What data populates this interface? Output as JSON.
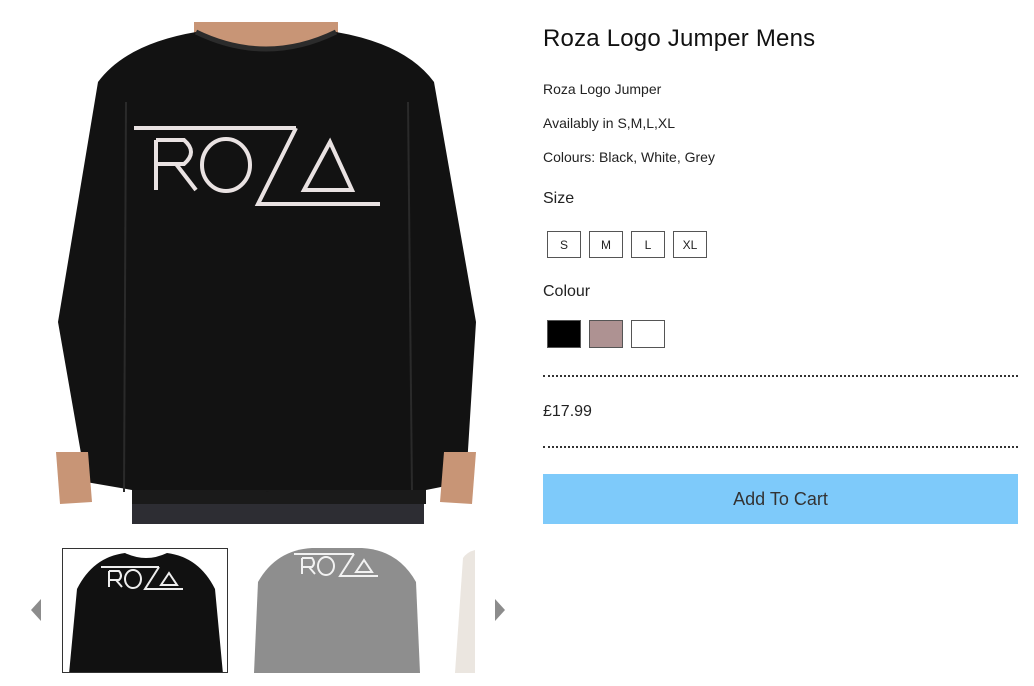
{
  "product": {
    "title": "Roza Logo Jumper Mens",
    "description_lines": [
      "Roza Logo Jumper",
      "Availably in S,M,L,XL",
      "Colours: Black, White, Grey"
    ],
    "price": "£17.99"
  },
  "options": {
    "size_label": "Size",
    "sizes": [
      "S",
      "M",
      "L",
      "XL"
    ],
    "colour_label": "Colour",
    "colours": [
      "#000000",
      "#ae9292",
      "#ffffff"
    ]
  },
  "cart": {
    "add_label": "Add To Cart",
    "button_color": "#7ecafa"
  },
  "gallery": {
    "logo_text": "ROZA",
    "thumbnails": [
      {
        "jumper_color": "#111111",
        "selected": true
      },
      {
        "jumper_color": "#8e8e8e",
        "selected": false
      },
      {
        "jumper_color": "#ebe6e0",
        "selected": false
      }
    ],
    "prev_icon": "caret-left-icon",
    "next_icon": "caret-right-icon"
  }
}
